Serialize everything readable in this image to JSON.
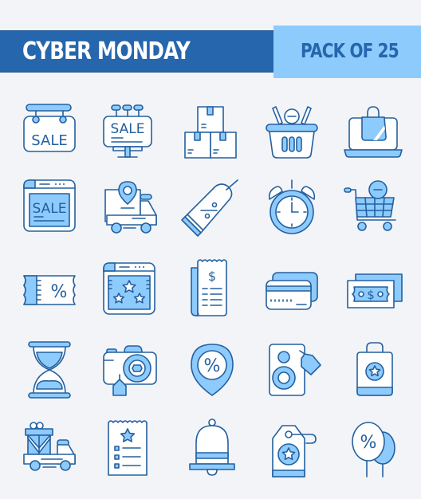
{
  "header": {
    "title": "CYBER MONDAY",
    "pack_label": "PACK OF 25"
  },
  "colors": {
    "primary": "#2566ad",
    "accent": "#8ecbfd",
    "stroke": "#24609f",
    "background": "#f2f4f8"
  },
  "icons": [
    {
      "name": "hanging-sale-sign-icon",
      "text": "SALE"
    },
    {
      "name": "sale-billboard-icon",
      "text": "SALE"
    },
    {
      "name": "stacked-boxes-icon"
    },
    {
      "name": "shopping-basket-icon"
    },
    {
      "name": "laptop-shopping-bag-icon"
    },
    {
      "name": "sale-webpage-icon",
      "text": "SALE"
    },
    {
      "name": "delivery-truck-location-icon"
    },
    {
      "name": "discount-tag-icon",
      "text": "%"
    },
    {
      "name": "alarm-clock-icon"
    },
    {
      "name": "shopping-cart-remove-icon"
    },
    {
      "name": "discount-coupon-icon",
      "text": "%"
    },
    {
      "name": "rating-webpage-icon"
    },
    {
      "name": "receipt-icon",
      "text": "$"
    },
    {
      "name": "credit-cards-icon"
    },
    {
      "name": "cash-money-icon",
      "text": "$"
    },
    {
      "name": "hourglass-icon"
    },
    {
      "name": "camera-tag-icon"
    },
    {
      "name": "discount-location-pin-icon",
      "text": "%"
    },
    {
      "name": "speaker-tag-icon"
    },
    {
      "name": "shopping-bag-star-icon"
    },
    {
      "name": "gift-delivery-truck-icon"
    },
    {
      "name": "wishlist-icon"
    },
    {
      "name": "notification-bell-icon"
    },
    {
      "name": "star-label-tag-icon"
    },
    {
      "name": "discount-balloons-icon",
      "text": "%"
    }
  ]
}
